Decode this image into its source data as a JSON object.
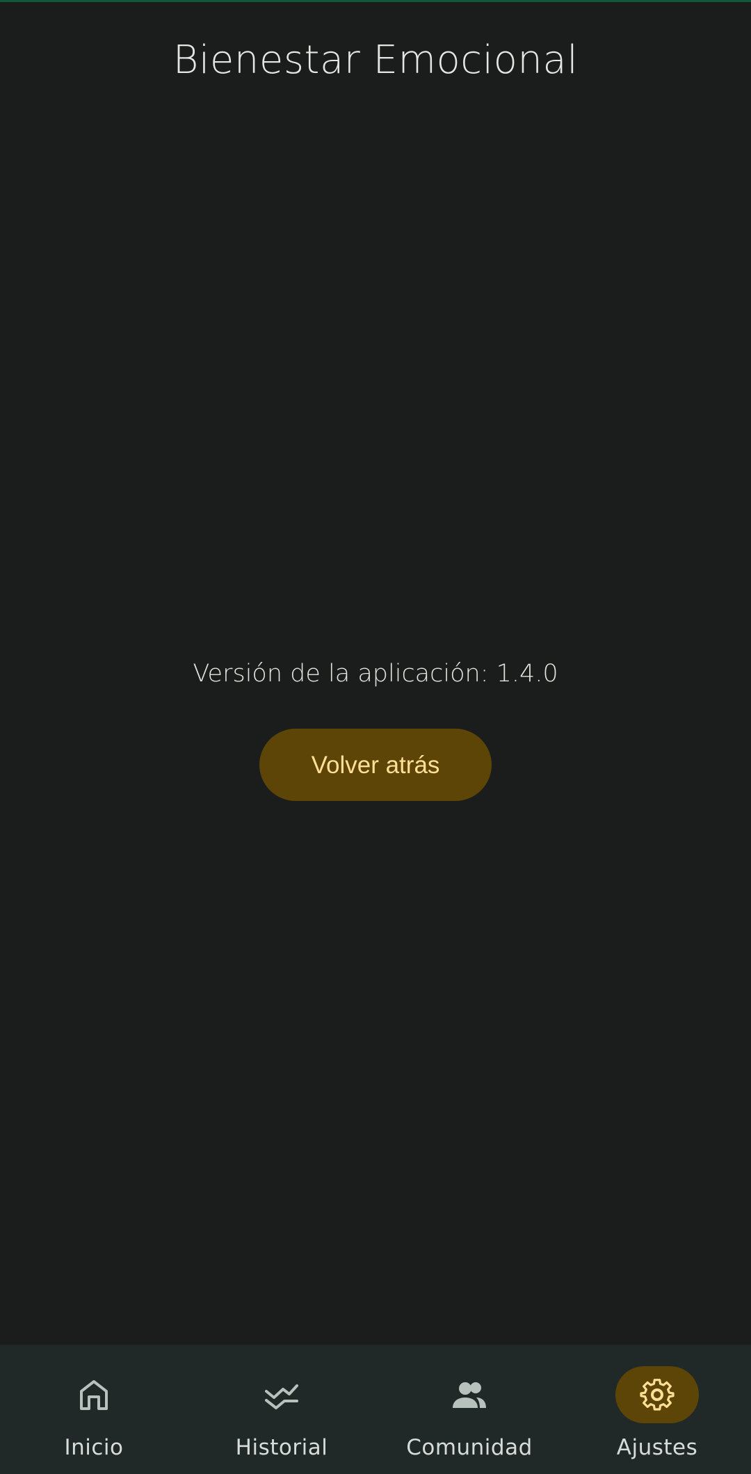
{
  "app": {
    "title": "Bienestar Emocional"
  },
  "content": {
    "version_text": "Versión de la aplicación: 1.4.0",
    "back_button_label": "Volver atrás"
  },
  "bottom_nav": {
    "items": [
      {
        "label": "Inicio",
        "icon": "home-icon",
        "active": false
      },
      {
        "label": "Historial",
        "icon": "history-icon",
        "active": false
      },
      {
        "label": "Comunidad",
        "icon": "people-icon",
        "active": false
      },
      {
        "label": "Ajustes",
        "icon": "gear-icon",
        "active": true
      }
    ]
  },
  "colors": {
    "background": "#1b1c1c",
    "nav_background": "#212928",
    "accent_container": "#5c4506",
    "accent_text": "#ffdf96",
    "icon_inactive": "#b8c2bd"
  }
}
